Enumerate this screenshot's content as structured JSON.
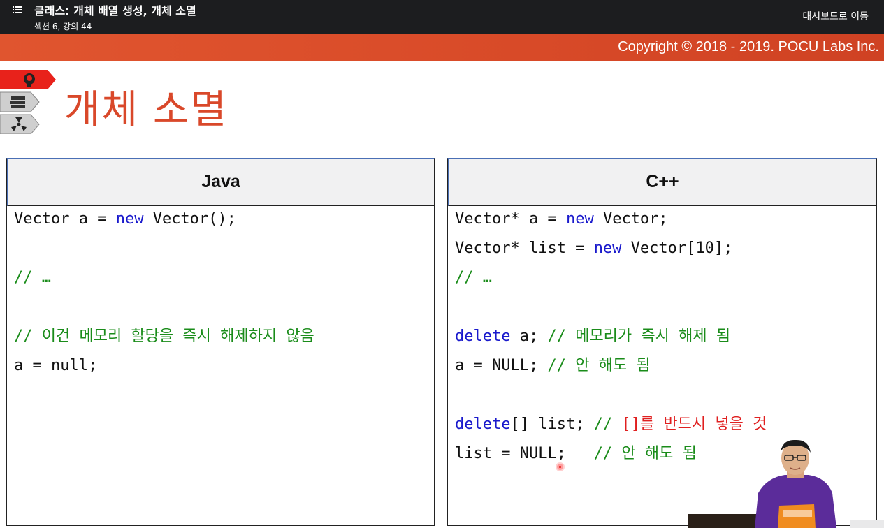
{
  "header": {
    "course_title": "클래스: 개체 배열 생성, 개체 소멸",
    "course_sub": "섹션 6, 강의 44",
    "dashboard_link": "대시보드로 이동",
    "menu_icon": "list-icon"
  },
  "band": {
    "copyright": "Copyright © 2018 - 2019. POCU Labs Inc."
  },
  "slide": {
    "title": "개체 소멸",
    "tab_icons": [
      "brain-icon",
      "book-stack-icon",
      "radiation-icon"
    ]
  },
  "java": {
    "heading": "Java",
    "lines": [
      [
        {
          "t": "Vector a = ",
          "c": "p"
        },
        {
          "t": "new",
          "c": "kw"
        },
        {
          "t": " Vector();",
          "c": "p"
        }
      ],
      [],
      [
        {
          "t": "// …",
          "c": "cm"
        }
      ],
      [],
      [
        {
          "t": "// 이건 메모리 할당을 즉시 해제하지 않음",
          "c": "cm"
        }
      ],
      [
        {
          "t": "a = null;",
          "c": "p"
        }
      ]
    ]
  },
  "cpp": {
    "heading": "C++",
    "lines": [
      [
        {
          "t": "Vector* a = ",
          "c": "p"
        },
        {
          "t": "new",
          "c": "kw"
        },
        {
          "t": " Vector;",
          "c": "p"
        }
      ],
      [
        {
          "t": "Vector* list = ",
          "c": "p"
        },
        {
          "t": "new",
          "c": "kw"
        },
        {
          "t": " Vector[10];",
          "c": "p"
        }
      ],
      [
        {
          "t": "// …",
          "c": "cm"
        }
      ],
      [],
      [
        {
          "t": "delete",
          "c": "kw"
        },
        {
          "t": " a; ",
          "c": "p"
        },
        {
          "t": "// 메모리가 즉시 해제 됨",
          "c": "cm"
        }
      ],
      [
        {
          "t": "a = NULL; ",
          "c": "p"
        },
        {
          "t": "// 안 해도 됨",
          "c": "cm"
        }
      ],
      [],
      [
        {
          "t": "delete",
          "c": "kw"
        },
        {
          "t": "[] list; ",
          "c": "p"
        },
        {
          "t": "// ",
          "c": "cm"
        },
        {
          "t": "[]를 반드시 넣을 것",
          "c": "red"
        }
      ],
      [
        {
          "t": "list = NULL;   ",
          "c": "p"
        },
        {
          "t": "// 안 해도 됨",
          "c": "cm"
        }
      ]
    ]
  },
  "colors": {
    "accent_orange": "#d9482a",
    "keyword_blue": "#1a1acc",
    "comment_green": "#1a8c1a",
    "warning_red": "#e02020"
  }
}
